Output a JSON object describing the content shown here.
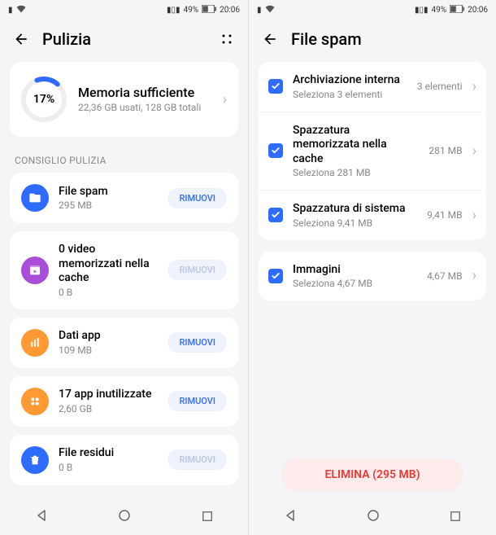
{
  "status": {
    "battery": "49%",
    "time": "20:06"
  },
  "screen1": {
    "title": "Pulizia",
    "memory": {
      "percent": "17%",
      "title": "Memoria sufficiente",
      "sub": "22,36 GB usati, 128 GB totali"
    },
    "section": "CONSIGLIO PULIZIA",
    "items": [
      {
        "title": "File spam",
        "sub": "295 MB",
        "btn": "RIMUOVI",
        "color": "ic-blue",
        "icon": "folder"
      },
      {
        "title": "0 video memorizzati nella cache",
        "sub": "0 B",
        "btn": "RIMUOVI",
        "color": "ic-purple",
        "icon": "video",
        "disabled": true
      },
      {
        "title": "Dati app",
        "sub": "109 MB",
        "btn": "RIMUOVI",
        "color": "ic-orange",
        "icon": "bars"
      },
      {
        "title": "17 app inutilizzate",
        "sub": "2,60 GB",
        "btn": "RIMUOVI",
        "color": "ic-orange2",
        "icon": "grid"
      },
      {
        "title": "File residui",
        "sub": "0 B",
        "btn": "RIMUOVI",
        "color": "ic-blue2",
        "icon": "trash",
        "disabled": true
      }
    ]
  },
  "screen2": {
    "title": "File spam",
    "groups": [
      [
        {
          "title": "Archiviazione interna",
          "sub": "Seleziona 3 elementi",
          "value": "3 elementi"
        },
        {
          "title": "Spazzatura memorizzata nella cache",
          "sub": "Seleziona 281 MB",
          "value": "281 MB"
        },
        {
          "title": "Spazzatura di sistema",
          "sub": "Seleziona 9,41 MB",
          "value": "9,41 MB"
        }
      ],
      [
        {
          "title": "Immagini",
          "sub": "Seleziona 4,67 MB",
          "value": "4,67 MB"
        }
      ]
    ],
    "delete": "ELIMINA (295 MB)"
  }
}
